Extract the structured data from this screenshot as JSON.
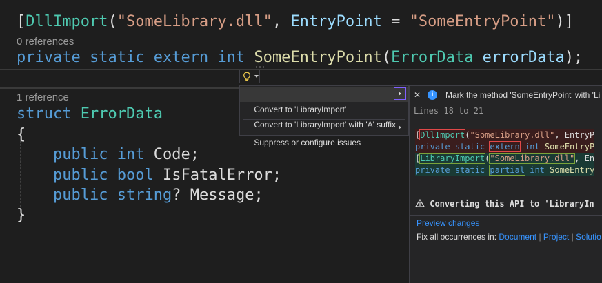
{
  "editor": {
    "line1": {
      "open_bracket": "[",
      "attr": "DllImport",
      "open_paren": "(",
      "lib": "\"SomeLibrary.dll\"",
      "comma": ", ",
      "entry_key": "EntryPoint",
      "eq": " = ",
      "entry_val": "\"SomeEntryPoint\"",
      "close": ")]"
    },
    "lens1": "0 references",
    "line2": {
      "kw1": "private",
      "kw2": "static",
      "kw3": "extern",
      "kw4": "int",
      "method": "SomeEntryPoint",
      "open": "(",
      "ptype": "ErrorData",
      "pname": "errorData",
      "close": ");"
    },
    "lens2": "1 reference",
    "line3": {
      "kw": "struct",
      "type": "ErrorData"
    },
    "brace_open": "{",
    "field1": {
      "kw1": "public",
      "type": "int",
      "name": "Code",
      "end": ";"
    },
    "field2": {
      "kw1": "public",
      "type": "bool",
      "name": "IsFatalError",
      "end": ";"
    },
    "field3": {
      "kw1": "public",
      "type": "string",
      "q": "?",
      "name": "Message",
      "end": ";"
    },
    "brace_close": "}"
  },
  "lightbulb": {
    "icon": "lightbulb-icon"
  },
  "quick_actions": {
    "items": [
      {
        "label": "Convert to 'LibraryImport'"
      },
      {
        "label": "Convert to 'LibraryImport' with 'A' suffix"
      },
      {
        "label": "Suppress or configure issues"
      }
    ]
  },
  "preview": {
    "close_glyph": "✕",
    "info_glyph": "i",
    "title": "Mark the method 'SomeEntryPoint' with 'Li",
    "lines": "Lines 18 to 21",
    "old1": {
      "b": "[",
      "attr": "DllImport",
      "p": "(",
      "lib": "\"SomeLibrary.dll\"",
      "rest": ", EntryP"
    },
    "old2": {
      "kw1": "private",
      "kw2": "static",
      "kw3": "extern",
      "kw4": "int",
      "rest": "SomeEntryP"
    },
    "new1": {
      "b": "[",
      "attr": "LibraryImport",
      "p": "(",
      "lib": "\"SomeLibrary.dll\"",
      "rest": ", En"
    },
    "new2": {
      "kw1": "private",
      "kw2": "static",
      "kw3": "partial",
      "kw4": "int",
      "rest": "SomeEntry"
    },
    "warning": "Converting this API to 'LibraryIn",
    "preview_changes": "Preview changes",
    "fix_all_label": "Fix all occurrences in:",
    "fix_document": "Document",
    "fix_project": "Project",
    "fix_solution": "Solutio"
  }
}
